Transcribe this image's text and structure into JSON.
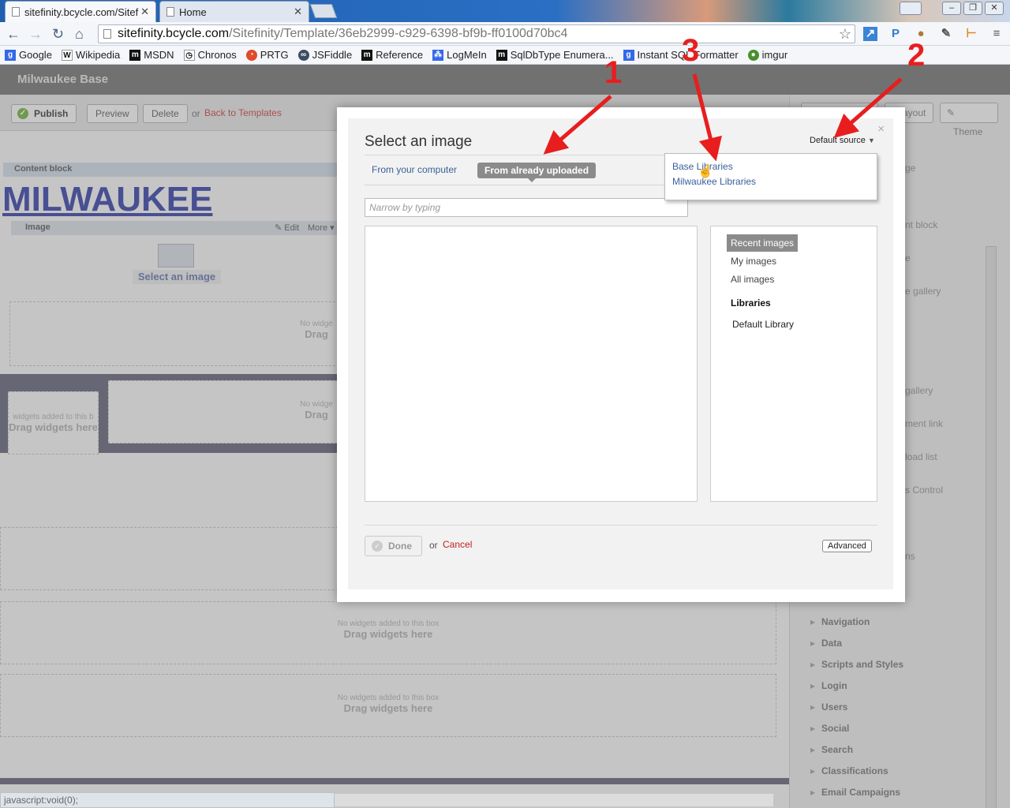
{
  "browser": {
    "tabs": [
      {
        "title": "sitefinity.bcycle.com/Sitef",
        "active": true
      },
      {
        "title": "Home",
        "active": false
      }
    ],
    "url_host": "sitefinity.bcycle.com",
    "url_path": "/Sitefinity/Template/36eb2999-c929-6398-bf9b-ff0100d70bc4",
    "bookmarks": [
      "Google",
      "Wikipedia",
      "MSDN",
      "Chronos",
      "PRTG",
      "JSFiddle",
      "Reference",
      "LogMeIn",
      "SqlDbType Enumera...",
      "Instant SQL Formatter",
      "imgur"
    ],
    "status_text": "javascript:void(0);"
  },
  "site": {
    "header_title": "Milwaukee Base",
    "actions": {
      "publish": "Publish",
      "preview": "Preview",
      "delete": "Delete",
      "or": "or",
      "back": "Back to Templates"
    },
    "content_block_label": "Content block",
    "heading": "MILWAUKEE",
    "image_widget": {
      "label": "Image",
      "edit": "Edit",
      "more": "More",
      "placeholder": "Select an image"
    },
    "dropzone": {
      "line1": "No widgets added to this box",
      "line2": "Drag widgets here"
    },
    "dropzone_partial": {
      "line1": "No widge",
      "line2": "Drag"
    },
    "dropzone_left": {
      "line1": "widgets added to this b",
      "line2": "Drag widgets here"
    },
    "right_panel": {
      "buttons": {
        "layout": "ayout",
        "theme": "Theme"
      },
      "visible_items": [
        "ge",
        "nt block",
        "e",
        "e gallery",
        "gallery",
        "ment link",
        "load list",
        "s Control",
        "ns"
      ],
      "categories": [
        "Navigation",
        "Data",
        "Scripts and Styles",
        "Login",
        "Users",
        "Social",
        "Search",
        "Classifications",
        "Email Campaigns"
      ]
    }
  },
  "modal": {
    "title": "Select an image",
    "source_label": "Default source",
    "tabs": {
      "computer": "From your computer",
      "uploaded": "From already uploaded"
    },
    "search_placeholder": "Narrow by typing",
    "filters": {
      "recent": "Recent images",
      "mine": "My images",
      "all": "All images"
    },
    "libraries_header": "Libraries",
    "default_library": "Default Library",
    "done": "Done",
    "or": "or",
    "cancel": "Cancel",
    "advanced": "Advanced",
    "close": "×"
  },
  "source_dropdown": {
    "options": [
      "Base Libraries",
      "Milwaukee Libraries"
    ]
  },
  "annotations": {
    "numbers": [
      "1",
      "2",
      "3"
    ],
    "color": "#e81e1e"
  }
}
